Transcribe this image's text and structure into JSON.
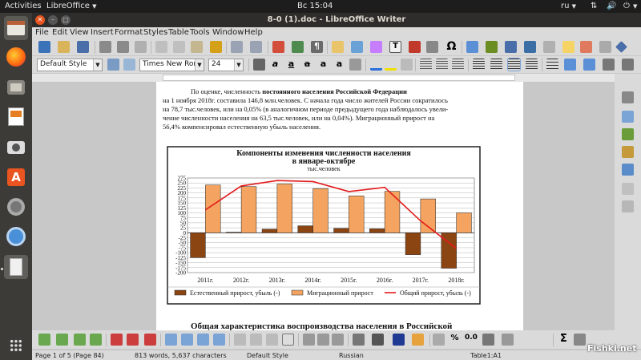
{
  "topbar": {
    "activities": "Activities",
    "app_name": "LibreOffice",
    "clock": "Вс 15:04",
    "keyboard_layout": "ru"
  },
  "window": {
    "title": "8-0 (1).doc - LibreOffice Writer"
  },
  "menu": [
    "File",
    "Edit",
    "View",
    "Insert",
    "Format",
    "Styles",
    "Table",
    "Tools",
    "Window",
    "Help"
  ],
  "formatting": {
    "paragraph_style": "Default Style",
    "font_name": "Times New Ron",
    "font_size": "24"
  },
  "document": {
    "para1_lead": "По оценке, численность",
    "para1_bold": "постоянного населения Российской Федерации",
    "para1_line2": "на 1 ноября 2018г. составила 146,8 млн.человек. С начала года число жителей России сократилось",
    "para1_line3": "на 78,7 тыс.человек, или на 0,05% (в аналогичном периоде предыдущего года наблюдалось увели-",
    "para1_line4": "чение численности населения на 63,5 тыс.человек, или на 0,04%). Миграционный прирост на",
    "para1_line5": "56,4% компенсировал естественную убыль населения.",
    "heading_bottom": "Общая характеристика воспроизводства населения в Российской"
  },
  "chart_data": {
    "type": "bar",
    "title_line1": "Компоненты изменения численности населения",
    "title_line2": "в январе-октябре",
    "subtitle": "тыс.человек",
    "categories": [
      "2011г.",
      "2012г.",
      "2013г.",
      "2014г.",
      "2015г.",
      "2016г.",
      "2017г.",
      "2018г."
    ],
    "series": [
      {
        "name": "Естественный прирост, убыль (-)",
        "type": "bar",
        "color": "#8b4513",
        "values": [
          -125,
          3,
          18,
          35,
          22,
          20,
          -110,
          -178
        ]
      },
      {
        "name": "Миграционный прирост",
        "type": "bar",
        "color": "#f4a460",
        "values": [
          240,
          232,
          245,
          222,
          185,
          208,
          170,
          100
        ]
      },
      {
        "name": "Общий прирост, убыль (-)",
        "type": "line",
        "color": "#e41a1c",
        "values": [
          115,
          235,
          262,
          257,
          207,
          228,
          60,
          -79
        ]
      }
    ],
    "y_ticks": [
      "275",
      "250",
      "225",
      "200",
      "175",
      "150",
      "125",
      "100",
      "75",
      "50",
      "25",
      "0",
      "-25",
      "-50",
      "-75",
      "-100",
      "-125",
      "-150",
      "-175",
      "-200"
    ],
    "ylim": [
      -200,
      275
    ],
    "grid": true,
    "legend_position": "bottom"
  },
  "statusbar": {
    "page": "Page 1 of 5 (Page 84)",
    "words": "813 words, 5,637 characters",
    "page_style": "Default Style",
    "language": "Russian",
    "cell": "Table1:A1"
  },
  "watermark": "Fishki.net",
  "colors": {
    "topbar": "#1d1d1d",
    "launcher": "#3c3b37",
    "accent_orange": "#e95420",
    "chart_bar_dark": "#8b4513",
    "chart_bar_light": "#f4a460",
    "chart_line": "#e41a1c"
  }
}
